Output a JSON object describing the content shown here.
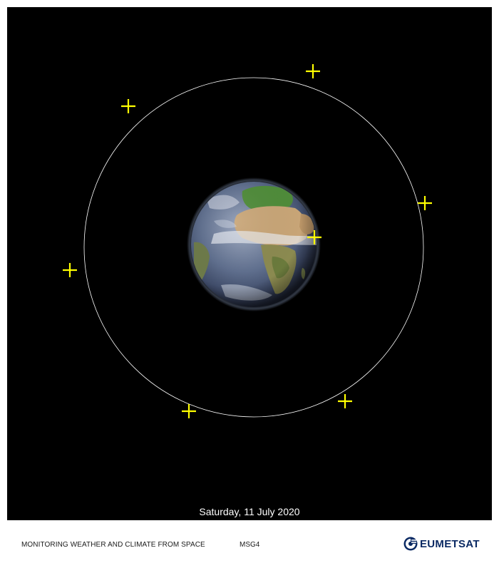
{
  "date_label": "Saturday, 11 July 2020",
  "footer": {
    "tagline": "MONITORING WEATHER AND CLIMATE FROM SPACE",
    "satellite": "MSG4",
    "logo_text": "EUMETSAT"
  },
  "colors": {
    "space_background": "#000000",
    "orbit_ring": "#ffffff",
    "satellite_markers": "#ffff00",
    "logo_brand": "#0b2a64"
  },
  "markers": {
    "count": 7,
    "symbol": "plus-cross-icon"
  }
}
